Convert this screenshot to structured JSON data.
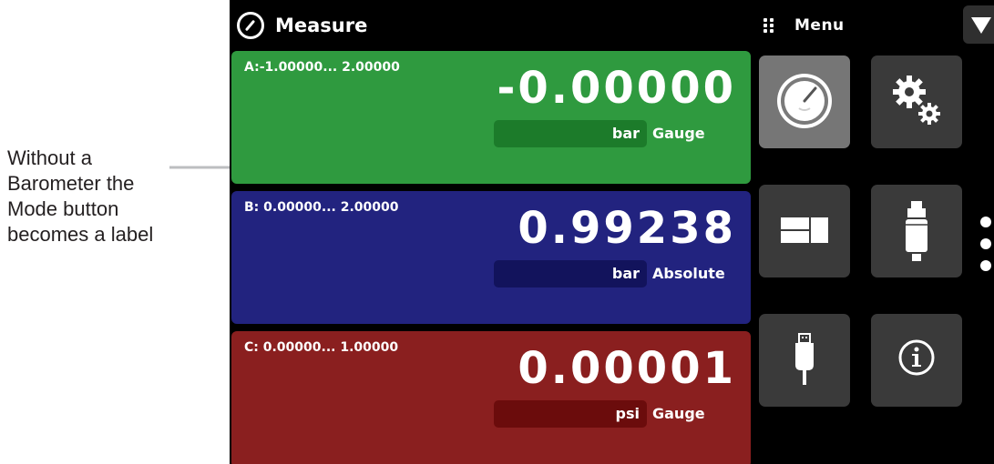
{
  "callout": {
    "lines": [
      "Without a",
      "Barometer the",
      "Mode button",
      "becomes a label"
    ]
  },
  "header": {
    "title": "Measure",
    "title_icon": "gauge-icon",
    "menu_label": "Menu",
    "menu_icon": "grip-icon",
    "dropdown_icon": "triangle-down-icon"
  },
  "channels": [
    {
      "id": "A",
      "range": "A:-1.00000... 2.00000",
      "value": "-0.00000",
      "unit": "bar",
      "mode": "Gauge",
      "color": "#2f9a3f"
    },
    {
      "id": "B",
      "range": "B: 0.00000... 2.00000",
      "value": "0.99238",
      "unit": "bar",
      "mode": "Absolute",
      "color": "#22237f"
    },
    {
      "id": "C",
      "range": "C: 0.00000... 1.00000",
      "value": "0.00001",
      "unit": "psi",
      "mode": "Gauge",
      "color": "#8a1f1f"
    }
  ],
  "menu_tiles": [
    {
      "icon": "gauge-icon",
      "active": true
    },
    {
      "icon": "gears-icon",
      "active": false
    },
    {
      "icon": "display-layout-icon",
      "active": false
    },
    {
      "icon": "sensor-icon",
      "active": false
    },
    {
      "icon": "usb-icon",
      "active": false
    },
    {
      "icon": "info-icon",
      "active": false
    }
  ],
  "pager": {
    "pages": 3,
    "current": 1
  }
}
